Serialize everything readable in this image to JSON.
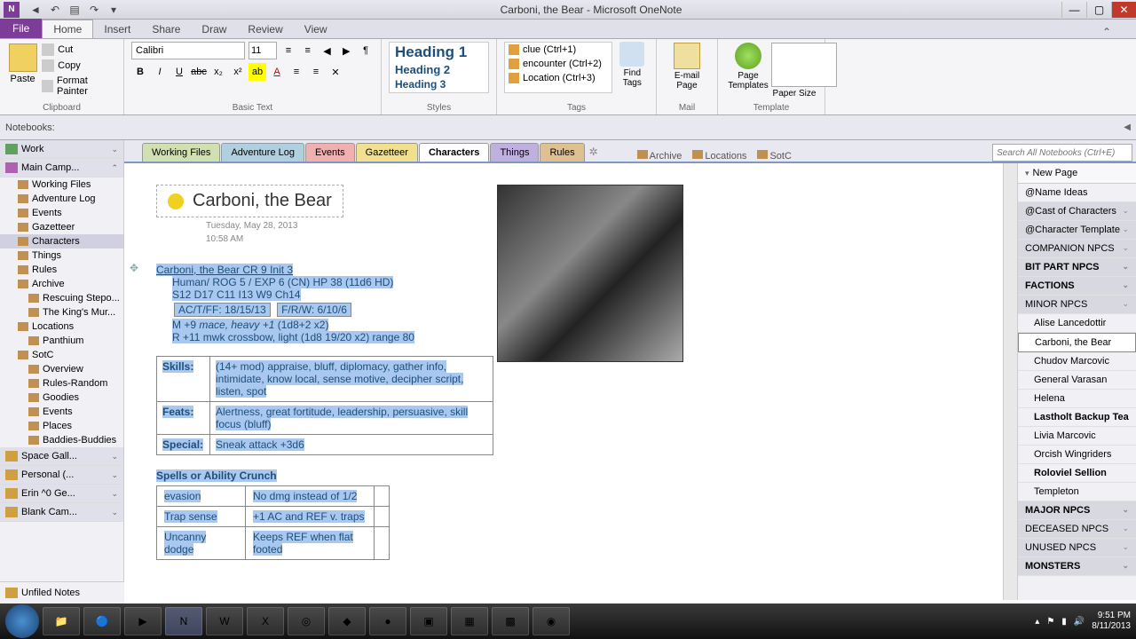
{
  "titlebar": {
    "title": "Carboni, the Bear - Microsoft OneNote"
  },
  "ribbon_tabs": {
    "file": "File",
    "tabs": [
      "Home",
      "Insert",
      "Share",
      "Draw",
      "Review",
      "View"
    ],
    "active": "Home"
  },
  "ribbon": {
    "clipboard": {
      "paste": "Paste",
      "cut": "Cut",
      "copy": "Copy",
      "format_painter": "Format Painter",
      "label": "Clipboard"
    },
    "basictext": {
      "font": "Calibri",
      "size": "11",
      "label": "Basic Text"
    },
    "styles": {
      "h1": "Heading 1",
      "h2": "Heading 2",
      "h3": "Heading 3",
      "label": "Styles"
    },
    "tags": {
      "t1": "clue (Ctrl+1)",
      "t2": "encounter (Ctrl+2)",
      "t3": "Location (Ctrl+3)",
      "find": "Find Tags",
      "label": "Tags"
    },
    "mail": {
      "email": "E-mail Page",
      "label": "Mail"
    },
    "template": {
      "pagetmpl": "Page Templates",
      "papersize": "Paper Size",
      "label": "Template"
    }
  },
  "nbbar": {
    "label": "Notebooks:"
  },
  "sidebar": {
    "work": "Work",
    "maincamp": "Main Camp...",
    "sections": [
      "Working Files",
      "Adventure Log",
      "Events",
      "Gazetteer",
      "Characters",
      "Things",
      "Rules",
      "Archive"
    ],
    "archive_subs": [
      "Rescuing Stepo...",
      "The King's Mur..."
    ],
    "locations": "Locations",
    "locations_subs": [
      "Panthium"
    ],
    "sotc": "SotC",
    "sotc_subs": [
      "Overview",
      "Rules-Random",
      "Goodies",
      "Events",
      "Places",
      "Baddies-Buddies"
    ],
    "notebooks": [
      "Space Gall...",
      "Personal (...",
      "Erin ^0 Ge...",
      "Blank Cam..."
    ],
    "unfiled": "Unfiled Notes"
  },
  "sectabs": {
    "tabs": [
      "Working Files",
      "Adventure Log",
      "Events",
      "Gazetteer",
      "Characters",
      "Things",
      "Rules"
    ],
    "quicklinks": [
      "Archive",
      "Locations",
      "SotC"
    ],
    "search_placeholder": "Search All Notebooks (Ctrl+E)"
  },
  "page": {
    "title": "Carboni, the Bear",
    "date": "Tuesday, May 28, 2013",
    "time": "10:58 AM",
    "stat_title": "Carboni, the Bear CR 9 Init 3",
    "stat_line1": "Human/ ROG 5 / EXP 6 (CN) HP 38 (11d6 HD)",
    "stat_line2": "S12 D17 C11 I13 W9 Ch14",
    "stat_ac": "AC/T/FF: 18/15/13",
    "stat_saves": "F/R/W: 6/10/6",
    "stat_melee_pre": "M +9 ",
    "stat_melee_em": "mace, heavy +1",
    "stat_melee_post": " (1d8+2 x2)",
    "stat_ranged": "R +11  mwk crossbow, light (1d8 19/20 x2) range 80",
    "skills_label": "Skills:",
    "skills_val": "(14+ mod) appraise, bluff, diplomacy, gather info, intimidate, know local, sense motive, decipher script, listen, spot",
    "feats_label": "Feats:",
    "feats_val": "Alertness, great fortitude, leadership, persuasive, skill focus (bluff)",
    "special_label": "Special:",
    "special_val": "Sneak attack +3d6",
    "spells_hdr": "Spells or Ability Crunch",
    "spells": [
      [
        "evasion",
        "No dmg instead of 1/2"
      ],
      [
        "Trap sense",
        "+1 AC  and REF v. traps"
      ],
      [
        "Uncanny dodge",
        "Keeps REF when flat footed"
      ]
    ]
  },
  "pagelist": {
    "newpage": "New Page",
    "items": [
      {
        "t": "@Name Ideas",
        "type": "item"
      },
      {
        "t": "@Cast of Characters",
        "type": "hdr"
      },
      {
        "t": "@Character Template",
        "type": "hdr"
      },
      {
        "t": "COMPANION NPCS",
        "type": "hdr"
      },
      {
        "t": "BIT PART NPCS",
        "type": "hdr",
        "bold": true
      },
      {
        "t": "FACTIONS",
        "type": "hdr",
        "bold": true
      },
      {
        "t": "MINOR NPCS",
        "type": "hdr"
      },
      {
        "t": "Alise Lancedottir",
        "type": "sub"
      },
      {
        "t": "Carboni, the Bear",
        "type": "sub",
        "active": true
      },
      {
        "t": "Chudov Marcovic",
        "type": "sub"
      },
      {
        "t": "General Varasan",
        "type": "sub"
      },
      {
        "t": "Helena",
        "type": "sub"
      },
      {
        "t": "Lastholt Backup Tea",
        "type": "sub",
        "bold": true
      },
      {
        "t": "Livia Marcovic",
        "type": "sub"
      },
      {
        "t": "Orcish Wingriders",
        "type": "sub"
      },
      {
        "t": "Roloviel Sellion",
        "type": "sub",
        "bold": true
      },
      {
        "t": "Templeton",
        "type": "sub"
      },
      {
        "t": "MAJOR NPCS",
        "type": "hdr",
        "bold": true
      },
      {
        "t": "DECEASED NPCS",
        "type": "hdr"
      },
      {
        "t": "UNUSED NPCS",
        "type": "hdr"
      },
      {
        "t": "MONSTERS",
        "type": "hdr",
        "bold": true
      }
    ]
  },
  "taskbar": {
    "time": "9:51 PM",
    "date": "8/11/2013"
  }
}
